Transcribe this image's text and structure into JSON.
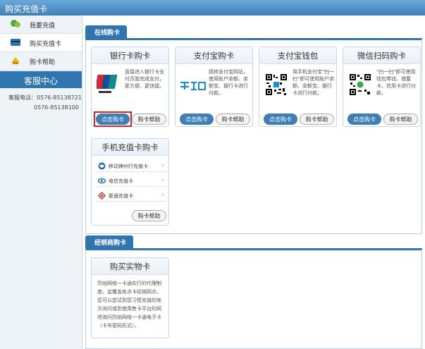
{
  "window": {
    "title": "购买充值卡"
  },
  "sidebar": {
    "items": [
      {
        "label": "我要充值",
        "icon": "recharge-icon"
      },
      {
        "label": "购买充值卡",
        "icon": "card-icon"
      },
      {
        "label": "购卡帮助",
        "icon": "help-icon"
      }
    ],
    "customer_service": {
      "title": "客服中心",
      "phone_label": "客服电话：",
      "phone1": "0576-85138721",
      "phone2": "0576-85138100"
    }
  },
  "online": {
    "tab": "在线购卡",
    "cards": [
      {
        "title": "银行卡购卡",
        "logo": "unionpay-logo",
        "desc": "直接进入银行卡支付页面完成支付，更方便、更快捷。",
        "buy": "点击购卡",
        "help": "购卡帮助"
      },
      {
        "title": "支付宝购卡",
        "logo": "alipay-logo",
        "desc": "跳转支付宝网站，使用账户余额、余额宝、银行卡进行付款。",
        "buy": "点击购卡",
        "help": "购卡帮助"
      },
      {
        "title": "支付宝钱包",
        "logo": "qr-code",
        "desc": "用手机支付宝\"扫一扫\"即可使用账户余额、余额宝、银行卡进行付款。",
        "buy": "点击购卡",
        "help": "购卡帮助"
      },
      {
        "title": "微信扫码购卡",
        "logo": "wechat-qr-code",
        "desc": "\"扫一扫\"即可使用钱包零钱、储蓄卡、信用卡进行付款。",
        "buy": "点击购卡",
        "help": "购卡帮助"
      }
    ],
    "phone_card": {
      "title": "手机充值卡购卡",
      "options": [
        {
          "label": "移动神州行充值卡",
          "icon": "china-mobile-icon"
        },
        {
          "label": "电信充值卡",
          "icon": "china-telecom-icon"
        },
        {
          "label": "联通充值卡",
          "icon": "china-unicom-icon"
        }
      ],
      "help": "购卡帮助"
    }
  },
  "dealer": {
    "tab": "经销商购卡",
    "card": {
      "title": "购买实物卡",
      "desc": "烈焰网络一卡通实行的代理制度，会覆盖各点卡经销网点，您可以尝试到您习惯充值的地方询问或到使用售卡平台的网吧询问烈焰网络一卡通电子卡（卡号密码形式）。"
    }
  },
  "colors": {
    "accent": "#2f75b2",
    "highlight": "#dd2222"
  }
}
